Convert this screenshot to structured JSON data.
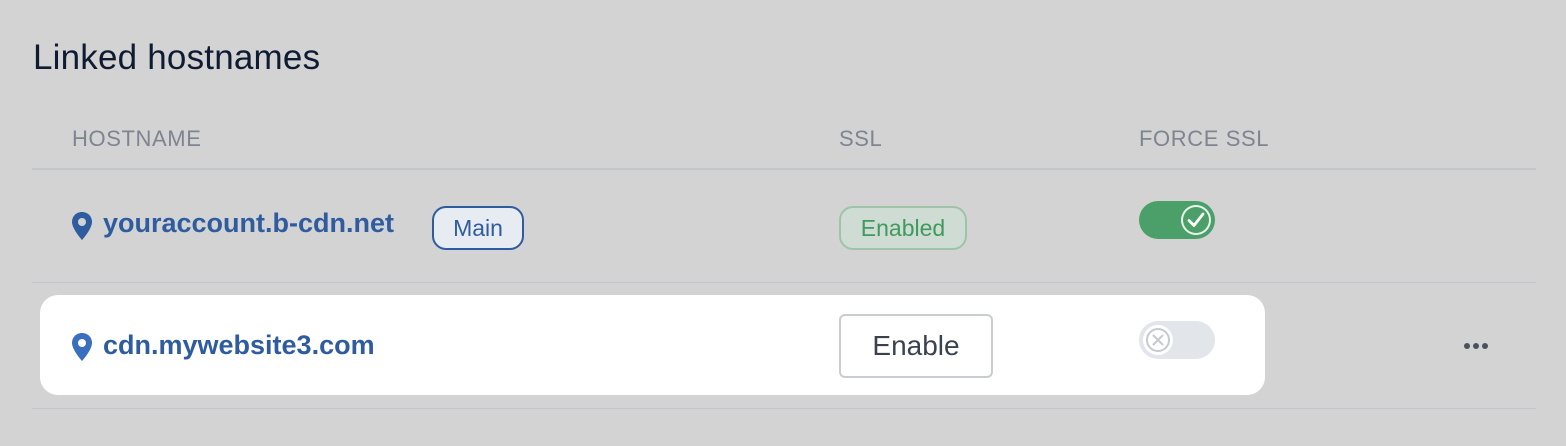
{
  "section": {
    "title": "Linked hostnames"
  },
  "table": {
    "headers": {
      "hostname": "HOSTNAME",
      "ssl": "SSL",
      "force_ssl": "FORCE SSL"
    },
    "rows": [
      {
        "hostname": "youraccount.b-cdn.net",
        "badge": "Main",
        "ssl_status": "Enabled",
        "force_ssl": true
      },
      {
        "hostname": "cdn.mywebsite3.com",
        "ssl_action": "Enable",
        "force_ssl": false,
        "highlighted": true
      }
    ]
  },
  "icons": {
    "hostname_icon": "location-pin-icon",
    "toggle_on_icon": "check-icon",
    "toggle_off_icon": "x-icon",
    "row_menu_icon": "more-horizontal-icon"
  },
  "colors": {
    "background": "#d3d3d3",
    "link": "#2e5c9e",
    "success": "#4aa068",
    "card": "#ffffff"
  }
}
